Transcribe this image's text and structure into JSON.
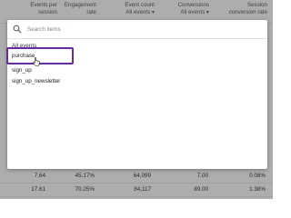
{
  "report": {
    "columns": [
      {
        "label": "Events per session",
        "sub": ""
      },
      {
        "label": "Engagement rate",
        "sub": ""
      },
      {
        "label": "Event count",
        "sub": "All events ▾"
      },
      {
        "label": "Conversions",
        "sub": "All events ▾"
      },
      {
        "label": "Session conversion rate",
        "sub": ""
      }
    ],
    "rows": [
      [
        "7.64",
        "45.17%",
        "64,099",
        "7.00",
        "0.08%"
      ],
      [
        "17.61",
        "70.25%",
        "84,117",
        "89.00",
        "1.38%"
      ]
    ]
  },
  "dropdown": {
    "search_placeholder": "Search items",
    "section_label": "All events",
    "items": [
      "purchase",
      "sign_up",
      "sign_up_newsletter"
    ],
    "highlighted_item": "purchase",
    "highlight_color": "#6a2c9d"
  }
}
